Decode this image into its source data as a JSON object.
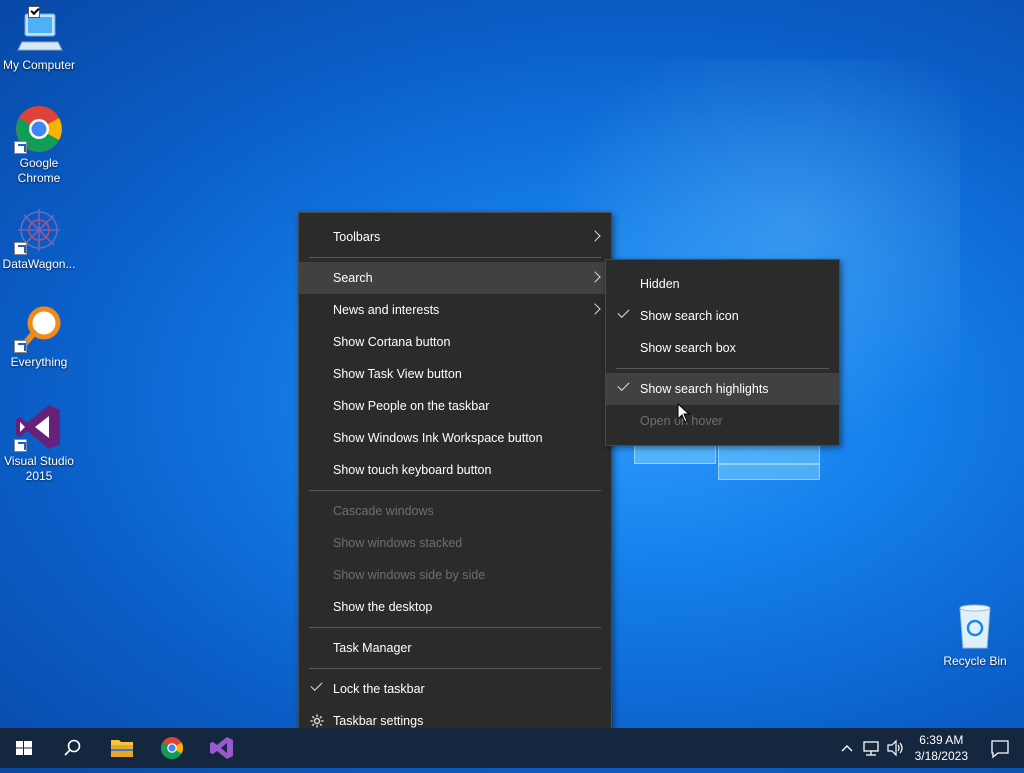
{
  "desktop": {
    "icons": [
      {
        "label": "My Computer"
      },
      {
        "label": "Google Chrome"
      },
      {
        "label": "DataWagon..."
      },
      {
        "label": "Everything"
      },
      {
        "label": "Visual Studio 2015"
      },
      {
        "label": "Recycle Bin"
      }
    ]
  },
  "context_menu": {
    "items": {
      "toolbars": "Toolbars",
      "search": "Search",
      "news": "News and interests",
      "cortana": "Show Cortana button",
      "taskview": "Show Task View button",
      "people": "Show People on the taskbar",
      "ink": "Show Windows Ink Workspace button",
      "keyboard": "Show touch keyboard button",
      "cascade": "Cascade windows",
      "stacked": "Show windows stacked",
      "sidebyside": "Show windows side by side",
      "desktop": "Show the desktop",
      "taskmanager": "Task Manager",
      "lock": "Lock the taskbar",
      "settings": "Taskbar settings"
    }
  },
  "search_submenu": {
    "hidden": "Hidden",
    "icon": "Show search icon",
    "box": "Show search box",
    "highlights": "Show search highlights",
    "hover": "Open on hover"
  },
  "taskbar": {
    "time": "6:39 AM",
    "date": "3/18/2023"
  },
  "colors": {
    "menu_bg": "#2b2b2b",
    "menu_highlight": "#414141",
    "taskbar_bg": "#15263f",
    "disabled_text": "#6f6f6f"
  }
}
